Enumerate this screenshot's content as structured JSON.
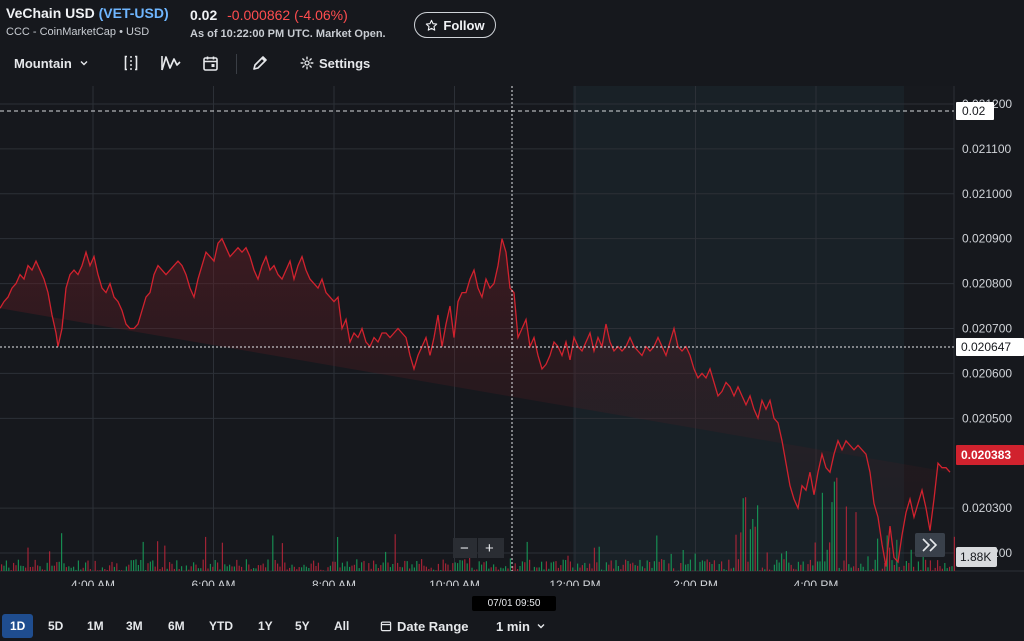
{
  "header": {
    "name": "VeChain USD",
    "ticker_open": "(",
    "ticker": "VET-USD",
    "ticker_close": ")",
    "source": "CCC - CoinMarketCap • USD",
    "price": "0.02",
    "change": "-0.000862",
    "change_pct": "(-4.06%)",
    "as_of": "As of 10:22:00 PM UTC. Market Open.",
    "follow_label": "Follow",
    "follow_icon": "star-outline-icon"
  },
  "toolbar": {
    "chart_type": "Mountain",
    "settings_label": "Settings",
    "icons": [
      "compare-icon",
      "indicators-icon",
      "calendar-icon",
      "draw-pencil-icon",
      "gear-icon"
    ]
  },
  "chart_data": {
    "type": "area",
    "x_ticks": [
      "4:00 AM",
      "6:00 AM",
      "8:00 AM",
      "10:00 AM",
      "12:00 PM",
      "2:00 PM",
      "4:00 PM"
    ],
    "y_ticks": [
      "0.021200",
      "0.021100",
      "0.021000",
      "0.020900",
      "0.020800",
      "0.020700",
      "0.020600",
      "0.020500",
      "0.020300",
      "0.020200"
    ],
    "ylim": [
      0.02016,
      0.02124
    ],
    "price_flags": {
      "prev_close": "0.02",
      "crosshair_price": "0.020647",
      "last_price": "0.020383"
    },
    "volume_label": "1.88K",
    "crosshair_time": "07/01 09:50",
    "zoom_out": "−",
    "zoom_in": "+",
    "line_color": "#d1222e",
    "x": [
      0,
      4,
      8,
      12,
      16,
      20,
      24,
      28,
      32,
      36,
      40,
      44,
      48,
      52,
      56,
      58,
      62,
      66,
      70,
      74,
      78,
      82,
      86,
      90,
      94,
      98,
      102,
      106,
      110,
      114,
      118,
      122,
      126,
      130,
      134,
      138,
      142,
      146,
      150,
      154,
      158,
      162,
      166,
      170,
      174,
      178,
      182,
      186,
      190,
      194,
      198,
      202,
      206,
      210,
      214,
      218,
      222,
      226,
      230,
      234,
      238,
      242,
      246,
      250,
      254,
      258,
      262,
      266,
      270,
      274,
      278,
      282,
      286,
      290,
      294,
      298,
      302,
      306,
      310,
      314,
      318,
      322,
      326,
      330,
      334,
      338,
      342,
      346,
      350,
      354,
      358,
      362,
      366,
      370,
      374,
      378,
      382,
      386,
      390,
      394,
      398,
      402,
      406,
      410,
      414,
      418,
      422,
      426,
      430,
      434,
      438,
      442,
      446,
      450,
      454,
      458,
      462,
      466,
      470,
      474,
      478,
      482,
      486,
      490,
      494,
      498,
      502,
      506,
      510,
      514,
      518,
      522,
      526,
      530,
      534,
      538,
      542,
      546,
      550,
      554,
      558,
      562,
      566,
      570,
      574,
      578,
      582,
      586,
      590,
      594,
      598,
      602,
      606,
      610,
      614,
      618,
      622,
      626,
      630,
      634,
      638,
      642,
      646,
      650,
      654,
      658,
      662,
      666,
      670,
      674,
      678,
      682,
      686,
      690,
      694,
      698,
      702,
      706,
      710,
      714,
      718,
      722,
      726,
      730,
      734,
      738,
      742,
      746,
      750,
      754,
      758,
      762,
      766,
      770,
      774,
      778,
      782,
      786,
      790,
      794,
      798,
      802,
      806,
      810,
      814,
      818,
      822,
      826,
      830,
      834,
      838,
      842,
      846,
      850,
      854,
      858,
      862,
      866,
      870,
      874,
      878,
      882,
      886,
      890,
      894,
      898,
      902,
      906,
      910,
      914,
      918,
      922,
      926,
      930,
      934,
      938,
      942,
      946,
      950
    ],
    "values": [
      0.020745,
      0.02076,
      0.02077,
      0.02079,
      0.0208,
      0.02082,
      0.02081,
      0.02084,
      0.02083,
      0.02085,
      0.02083,
      0.02081,
      0.02078,
      0.02073,
      0.02069,
      0.02066,
      0.0207,
      0.02079,
      0.02082,
      0.02083,
      0.02082,
      0.02084,
      0.02087,
      0.02084,
      0.02086,
      0.02082,
      0.02079,
      0.02078,
      0.0208,
      0.02077,
      0.02076,
      0.02074,
      0.02071,
      0.0207,
      0.0207,
      0.02071,
      0.02074,
      0.02077,
      0.02078,
      0.02082,
      0.02084,
      0.02083,
      0.02082,
      0.02083,
      0.02084,
      0.02085,
      0.02084,
      0.02082,
      0.02079,
      0.02077,
      0.02081,
      0.02084,
      0.02087,
      0.02086,
      0.02085,
      0.02089,
      0.0209,
      0.02088,
      0.02086,
      0.02087,
      0.02088,
      0.02087,
      0.02088,
      0.02086,
      0.02083,
      0.02081,
      0.02084,
      0.02086,
      0.02083,
      0.02084,
      0.02082,
      0.02081,
      0.02083,
      0.02085,
      0.02081,
      0.02084,
      0.02086,
      0.02083,
      0.02081,
      0.0208,
      0.02079,
      0.02081,
      0.02078,
      0.02077,
      0.02076,
      0.02077,
      0.0207,
      0.02072,
      0.02067,
      0.02069,
      0.02068,
      0.0207,
      0.02067,
      0.02066,
      0.02068,
      0.02067,
      0.02069,
      0.02069,
      0.02068,
      0.02069,
      0.0207,
      0.02069,
      0.02068,
      0.02064,
      0.02061,
      0.02064,
      0.02066,
      0.02068,
      0.02064,
      0.02068,
      0.02073,
      0.02066,
      0.02071,
      0.02075,
      0.02068,
      0.02076,
      0.02078,
      0.02078,
      0.02081,
      0.02083,
      0.02079,
      0.02077,
      0.02081,
      0.02079,
      0.0208,
      0.02084,
      0.0209,
      0.02087,
      0.02079,
      0.02078,
      0.02068,
      0.0207,
      0.02072,
      0.02066,
      0.02068,
      0.02064,
      0.02061,
      0.02062,
      0.02064,
      0.02067,
      0.02066,
      0.02064,
      0.02067,
      0.02063,
      0.02068,
      0.02066,
      0.02065,
      0.02067,
      0.02069,
      0.02065,
      0.02068,
      0.02066,
      0.02071,
      0.02067,
      0.02065,
      0.02066,
      0.02065,
      0.02066,
      0.02068,
      0.02066,
      0.02065,
      0.02064,
      0.02066,
      0.02065,
      0.02066,
      0.02068,
      0.02066,
      0.02064,
      0.02067,
      0.0207,
      0.02066,
      0.02065,
      0.02066,
      0.02064,
      0.02061,
      0.02059,
      0.0206,
      0.02059,
      0.02061,
      0.02058,
      0.02055,
      0.02056,
      0.02058,
      0.02057,
      0.02055,
      0.02057,
      0.02055,
      0.02053,
      0.02055,
      0.02052,
      0.0205,
      0.02054,
      0.02052,
      0.02054,
      0.0205,
      0.02049,
      0.02045,
      0.0204,
      0.02035,
      0.02032,
      0.0203,
      0.02035,
      0.02034,
      0.02038,
      0.02033,
      0.02038,
      0.02042,
      0.02039,
      0.02038,
      0.02042,
      0.02045,
      0.02043,
      0.02045,
      0.02044,
      0.02043,
      0.02044,
      0.02043,
      0.02042,
      0.02038,
      0.02031,
      0.02028,
      0.02022,
      0.02017,
      0.02026,
      0.02019,
      0.02018,
      0.02024,
      0.02029,
      0.02032,
      0.02028,
      0.02031,
      0.02034,
      0.0203,
      0.02025,
      0.02032,
      0.0204,
      0.02039,
      0.02039,
      0.02038,
      0.02039,
      0.02038,
      0.0204,
      0.02037,
      0.02036,
      0.02038
    ]
  },
  "bottom": {
    "ranges": [
      "1D",
      "5D",
      "1M",
      "3M",
      "6M",
      "YTD",
      "1Y",
      "5Y",
      "All"
    ],
    "active_range": "1D",
    "date_range_label": "Date Range",
    "interval_label": "1 min"
  }
}
